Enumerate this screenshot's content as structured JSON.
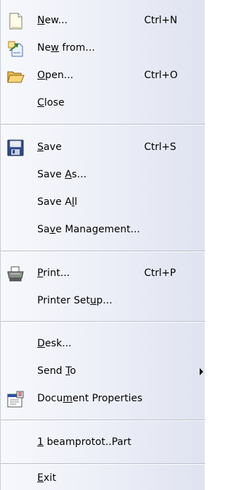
{
  "menu": {
    "items": [
      {
        "pre": "",
        "key": "N",
        "post": "ew...",
        "shortcut": "Ctrl+N",
        "icon": "new-document-icon"
      },
      {
        "pre": "Ne",
        "key": "w",
        "post": " from...",
        "shortcut": "",
        "icon": "new-from-icon"
      },
      {
        "pre": "",
        "key": "O",
        "post": "pen...",
        "shortcut": "Ctrl+O",
        "icon": "open-folder-icon"
      },
      {
        "pre": "",
        "key": "C",
        "post": "lose",
        "shortcut": "",
        "icon": ""
      },
      {
        "pre": "",
        "key": "S",
        "post": "ave",
        "shortcut": "Ctrl+S",
        "icon": "save-disk-icon"
      },
      {
        "pre": "Save ",
        "key": "A",
        "post": "s...",
        "shortcut": "",
        "icon": ""
      },
      {
        "pre": "Save A",
        "key": "l",
        "post": "l",
        "shortcut": "",
        "icon": ""
      },
      {
        "pre": "Sa",
        "key": "v",
        "post": "e Management...",
        "shortcut": "",
        "icon": ""
      },
      {
        "pre": "",
        "key": "P",
        "post": "rint...",
        "shortcut": "Ctrl+P",
        "icon": "printer-icon"
      },
      {
        "pre": "Printer Set",
        "key": "u",
        "post": "p...",
        "shortcut": "",
        "icon": ""
      },
      {
        "pre": "",
        "key": "D",
        "post": "esk...",
        "shortcut": "",
        "icon": ""
      },
      {
        "pre": "Send ",
        "key": "T",
        "post": "o",
        "shortcut": "",
        "icon": "submenu-arrow-icon"
      },
      {
        "pre": "Docu",
        "key": "m",
        "post": "ent Properties",
        "shortcut": "",
        "icon": "document-properties-icon"
      },
      {
        "pre": "",
        "key": "1",
        "post": " beamprotot..Part",
        "shortcut": "",
        "icon": ""
      },
      {
        "pre": "",
        "key": "E",
        "post": "xit",
        "shortcut": "",
        "icon": ""
      }
    ]
  }
}
